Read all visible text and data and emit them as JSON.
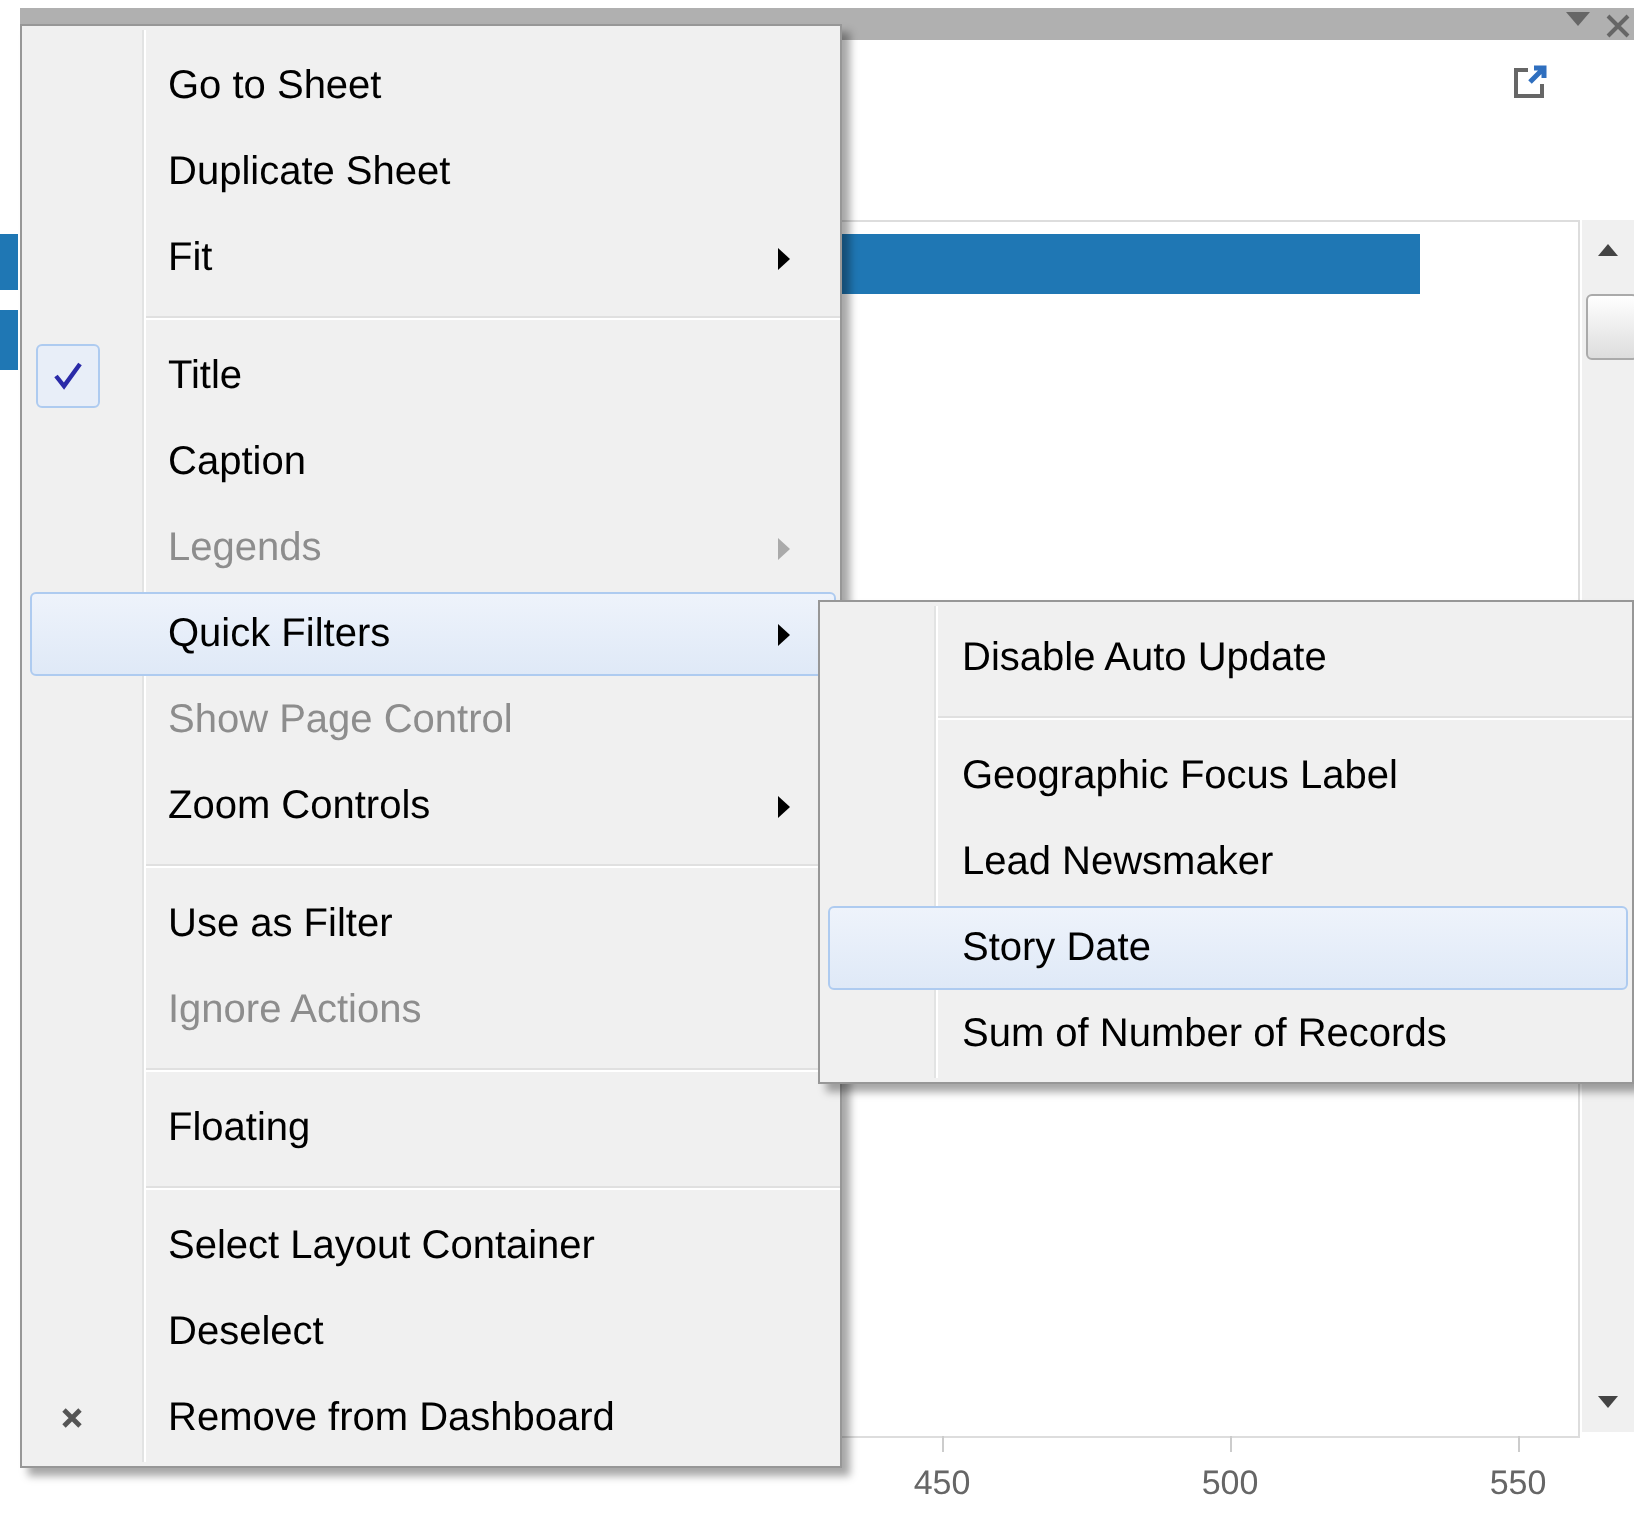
{
  "chart": {
    "axis_ticks": [
      "450",
      "500",
      "550"
    ]
  },
  "context_menu": {
    "items": [
      {
        "kind": "item",
        "label": "Go to Sheet",
        "checked": false,
        "disabled": false,
        "submenu": false,
        "selected": false
      },
      {
        "kind": "item",
        "label": "Duplicate Sheet",
        "checked": false,
        "disabled": false,
        "submenu": false,
        "selected": false
      },
      {
        "kind": "item",
        "label": "Fit",
        "checked": false,
        "disabled": false,
        "submenu": true,
        "selected": false
      },
      {
        "kind": "separator"
      },
      {
        "kind": "item",
        "label": "Title",
        "checked": true,
        "disabled": false,
        "submenu": false,
        "selected": false
      },
      {
        "kind": "item",
        "label": "Caption",
        "checked": false,
        "disabled": false,
        "submenu": false,
        "selected": false
      },
      {
        "kind": "item",
        "label": "Legends",
        "checked": false,
        "disabled": true,
        "submenu": true,
        "selected": false
      },
      {
        "kind": "item",
        "label": "Quick Filters",
        "checked": false,
        "disabled": false,
        "submenu": true,
        "selected": true
      },
      {
        "kind": "item",
        "label": "Show Page Control",
        "checked": false,
        "disabled": true,
        "submenu": false,
        "selected": false
      },
      {
        "kind": "item",
        "label": "Zoom Controls",
        "checked": false,
        "disabled": false,
        "submenu": true,
        "selected": false
      },
      {
        "kind": "separator"
      },
      {
        "kind": "item",
        "label": "Use as Filter",
        "checked": false,
        "disabled": false,
        "submenu": false,
        "selected": false
      },
      {
        "kind": "item",
        "label": "Ignore Actions",
        "checked": false,
        "disabled": true,
        "submenu": false,
        "selected": false
      },
      {
        "kind": "separator"
      },
      {
        "kind": "item",
        "label": "Floating",
        "checked": false,
        "disabled": false,
        "submenu": false,
        "selected": false
      },
      {
        "kind": "separator"
      },
      {
        "kind": "item",
        "label": "Select Layout Container",
        "checked": false,
        "disabled": false,
        "submenu": false,
        "selected": false
      },
      {
        "kind": "item",
        "label": "Deselect",
        "checked": false,
        "disabled": false,
        "submenu": false,
        "selected": false
      },
      {
        "kind": "remove_item",
        "label": "Remove from Dashboard",
        "checked": false,
        "disabled": false,
        "submenu": false,
        "selected": false
      }
    ]
  },
  "submenu": {
    "items": [
      {
        "kind": "item",
        "label": "Disable Auto Update",
        "selected": false
      },
      {
        "kind": "separator"
      },
      {
        "kind": "item",
        "label": "Geographic Focus Label",
        "selected": false
      },
      {
        "kind": "item",
        "label": "Lead Newsmaker",
        "selected": false
      },
      {
        "kind": "item",
        "label": "Story Date",
        "selected": true
      },
      {
        "kind": "item",
        "label": "Sum of Number of Records",
        "selected": false
      }
    ]
  }
}
